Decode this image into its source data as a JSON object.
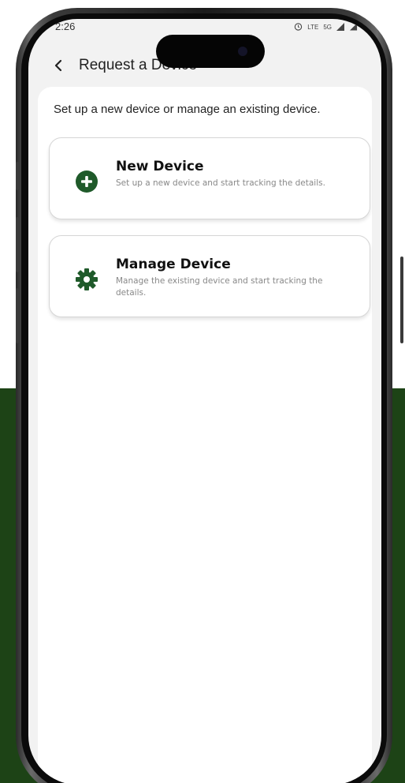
{
  "status_bar": {
    "time": "2:26",
    "network_label": "LTE",
    "signal_label": "5G"
  },
  "header": {
    "title": "Request a Device"
  },
  "main": {
    "subtitle": "Set up a new device or manage an existing device.",
    "options": [
      {
        "title": "New Device",
        "description": "Set up a new device and start tracking the details."
      },
      {
        "title": "Manage Device",
        "description": "Manage the existing device and start tracking the details."
      }
    ]
  },
  "colors": {
    "accent": "#1f5a2a",
    "background_band": "#1d4316"
  },
  "icons": {
    "back": "chevron-left-icon",
    "new_device": "plus-circle-icon",
    "manage_device": "gear-icon"
  }
}
